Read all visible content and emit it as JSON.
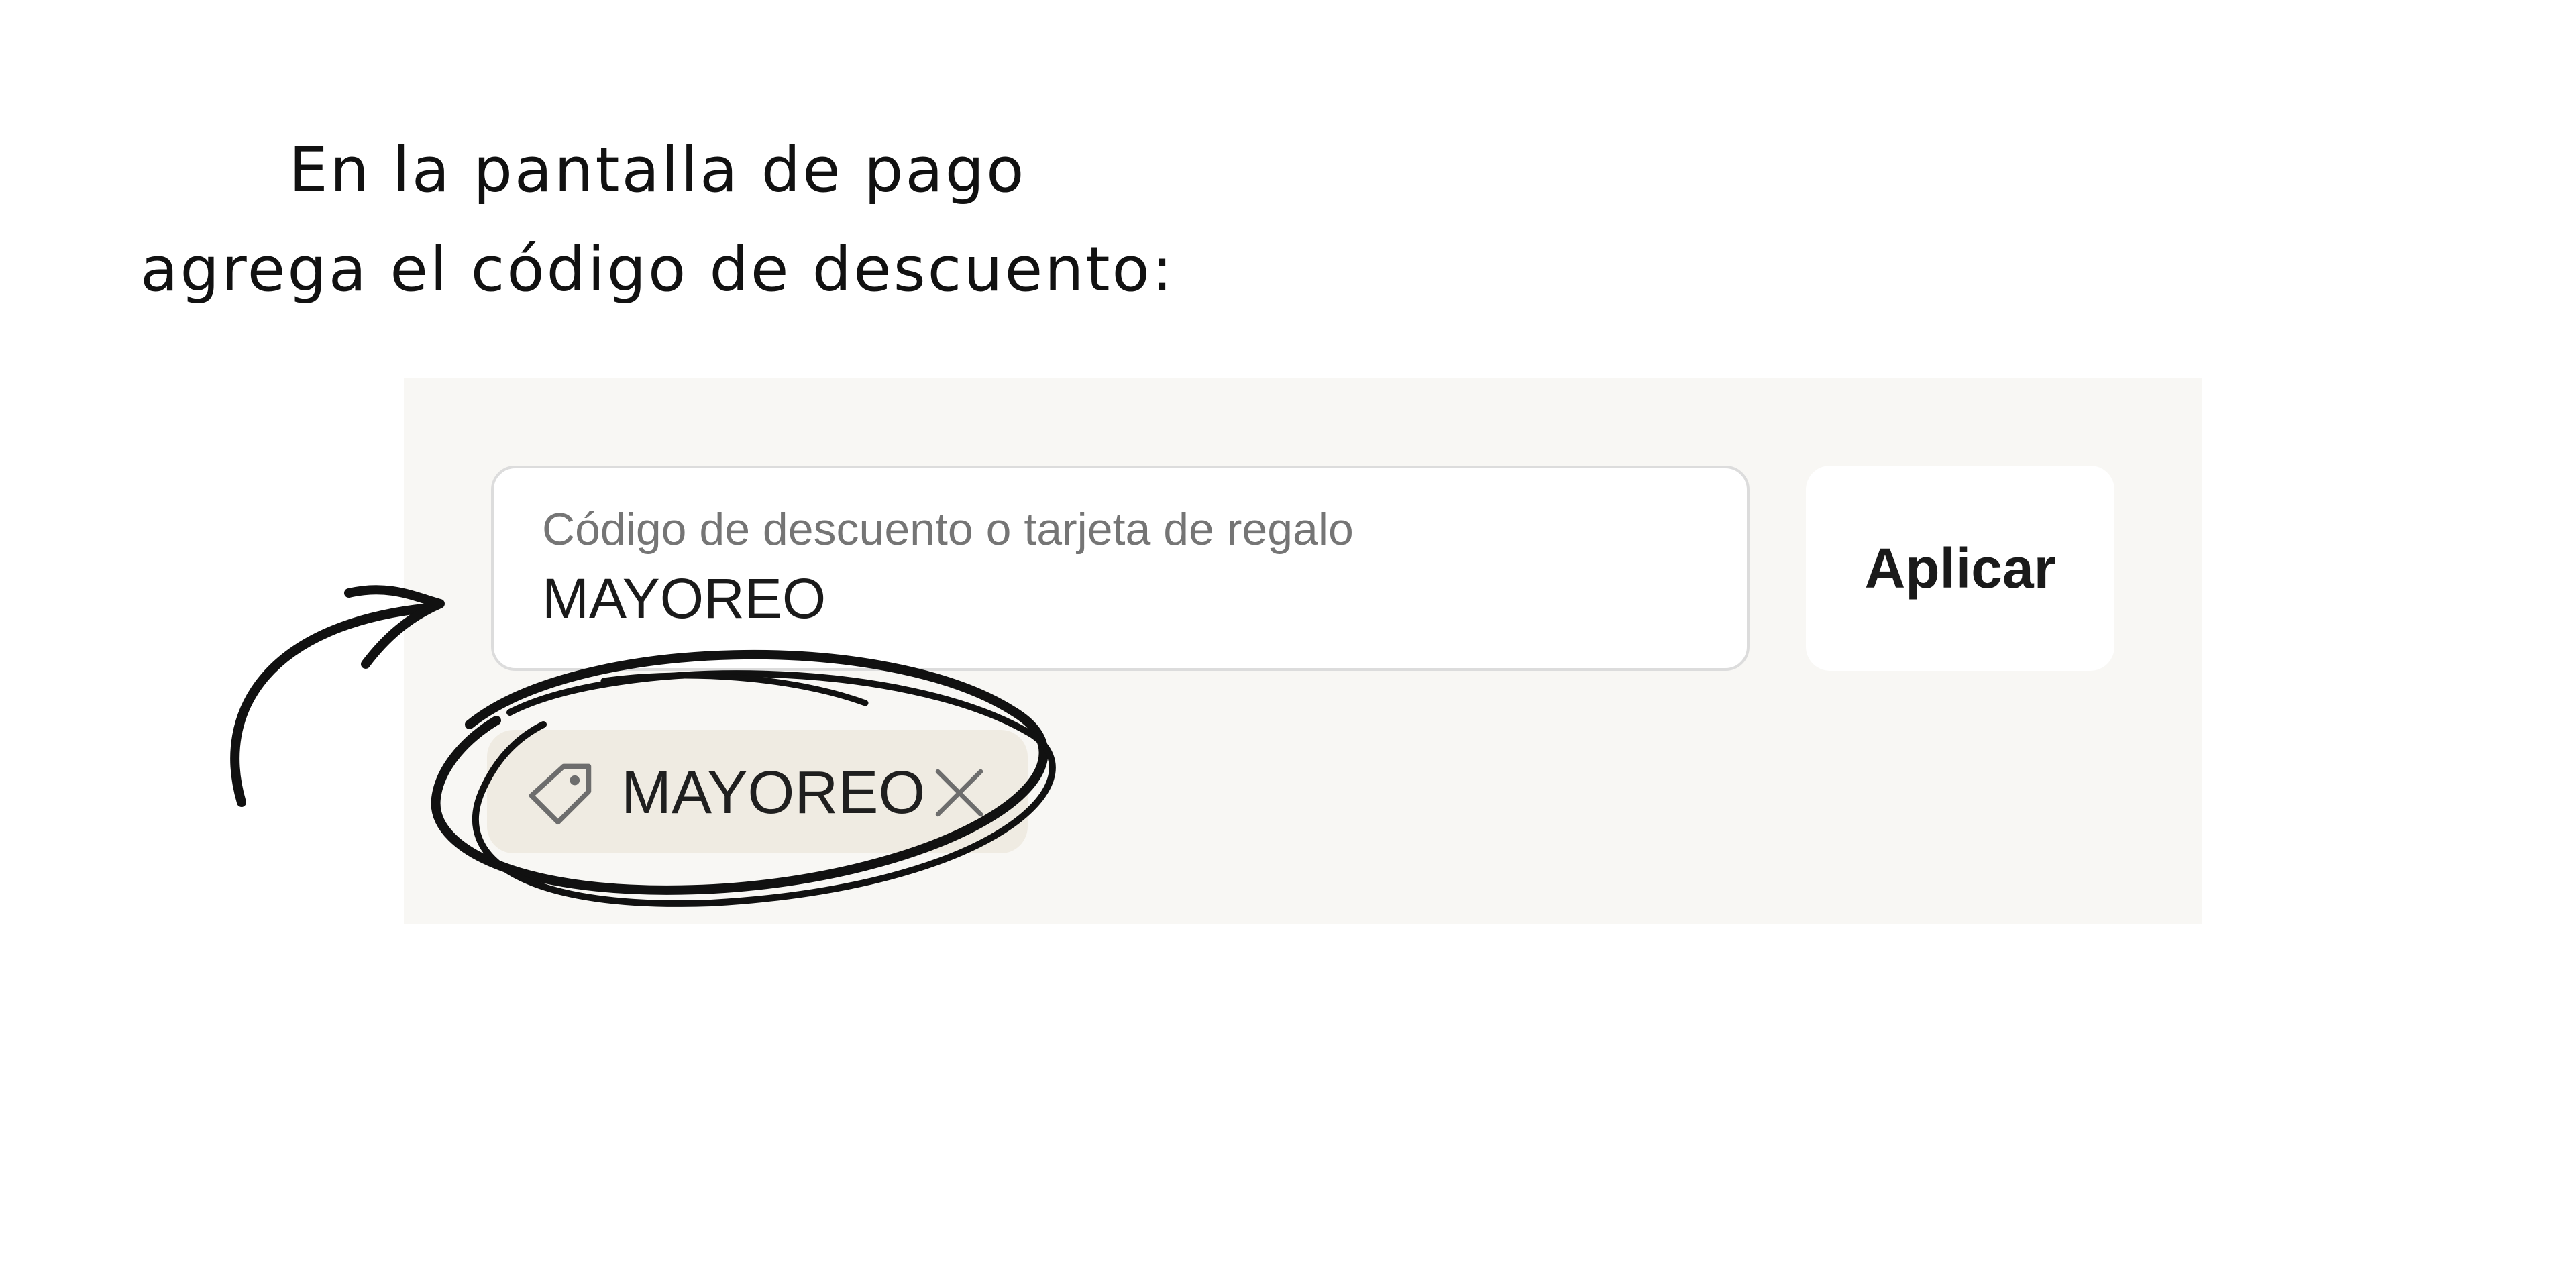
{
  "instruction": {
    "line1": "En la pantalla de pago",
    "line2": "agrega el código de descuento:"
  },
  "discount_form": {
    "field_label": "Código de descuento o tarjeta de regalo",
    "field_value": "MAYOREO",
    "apply_label": "Aplicar"
  },
  "applied_discount": {
    "code": "MAYOREO",
    "icon": "tag-icon",
    "remove_icon": "close-icon"
  },
  "annotation": {
    "arrow_icon": "hand-drawn-arrow",
    "highlight": "hand-drawn-circle"
  },
  "colors": {
    "panel_background": "#f8f7f4",
    "tag_background": "#efebe2",
    "text": "#1a1a1a",
    "muted_text": "#757575"
  }
}
